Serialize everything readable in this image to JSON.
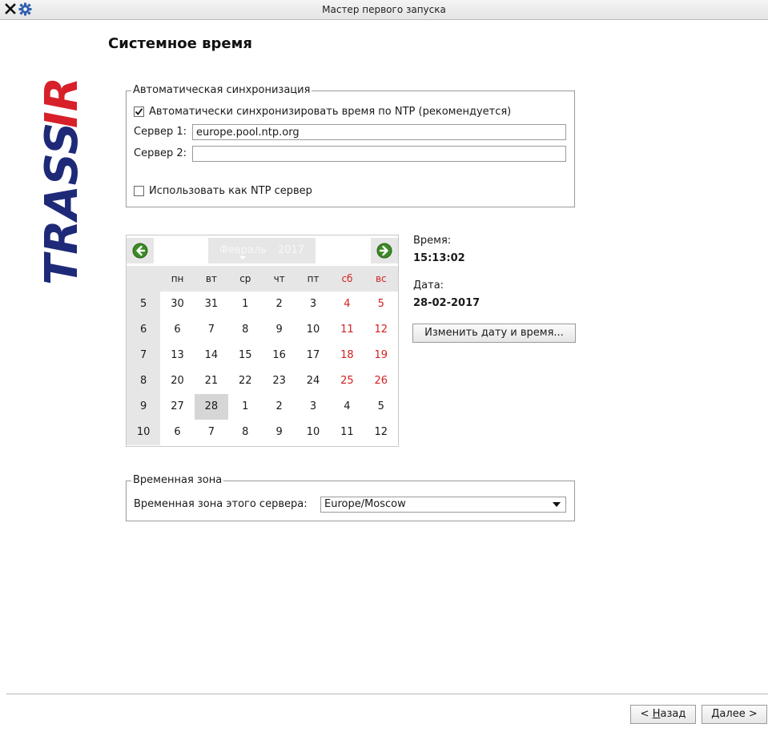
{
  "window": {
    "title": "Мастер первого запуска"
  },
  "logo": {
    "text": "TRASSIR",
    "colors": {
      "red": "#d8202a",
      "blue": "#1e2a78"
    }
  },
  "page": {
    "title": "Системное время"
  },
  "auto_sync": {
    "legend": "Автоматическая синхронизация",
    "ntp_checkbox": {
      "label": "Автоматически синхронизировать время по NTP (рекомендуется)",
      "checked": true
    },
    "server1": {
      "label": "Сервер 1:",
      "value": "europe.pool.ntp.org"
    },
    "server2": {
      "label": "Сервер 2:",
      "value": ""
    },
    "use_as_server": {
      "label": "Использовать как NTP сервер",
      "checked": false
    }
  },
  "calendar": {
    "month": "Февраль",
    "year": "2017",
    "weekday_headers": [
      "пн",
      "вт",
      "ср",
      "чт",
      "пт",
      "сб",
      "вс"
    ],
    "weeks": [
      {
        "num": "5",
        "days": [
          "30",
          "31",
          "1",
          "2",
          "3",
          "4",
          "5"
        ]
      },
      {
        "num": "6",
        "days": [
          "6",
          "7",
          "8",
          "9",
          "10",
          "11",
          "12"
        ]
      },
      {
        "num": "7",
        "days": [
          "13",
          "14",
          "15",
          "16",
          "17",
          "18",
          "19"
        ]
      },
      {
        "num": "8",
        "days": [
          "20",
          "21",
          "22",
          "23",
          "24",
          "25",
          "26"
        ]
      },
      {
        "num": "9",
        "days": [
          "27",
          "28",
          "1",
          "2",
          "3",
          "4",
          "5"
        ]
      },
      {
        "num": "10",
        "days": [
          "6",
          "7",
          "8",
          "9",
          "10",
          "11",
          "12"
        ]
      }
    ],
    "selected": {
      "week": 4,
      "day": 1
    },
    "weekend_color": "#d42020",
    "highlight_weekends_rows": [
      0,
      1,
      2,
      3
    ],
    "highlight_weekend_headers": true,
    "icons": {
      "prev": "arrow-left-circle-icon",
      "next": "arrow-right-circle-icon"
    },
    "nav_color": "#3c8a25"
  },
  "time_info": {
    "time_label": "Время:",
    "time_value": "15:13:02",
    "date_label": "Дата:",
    "date_value": "28-02-2017",
    "change_button": "Изменить дату и время..."
  },
  "timezone": {
    "legend": "Временная зона",
    "label": "Временная зона этого сервера:",
    "value": "Europe/Moscow"
  },
  "footer": {
    "back_prefix": "< ",
    "back_accel": "Н",
    "back_rest": "азад",
    "next_accel": "Д",
    "next_rest": "алее >"
  }
}
